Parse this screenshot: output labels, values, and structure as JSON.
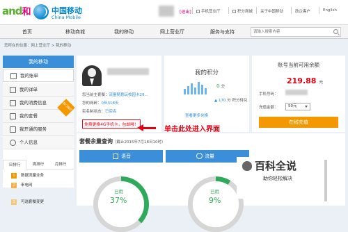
{
  "brand": {
    "and_text": "and",
    "he_text": "和",
    "name_cn": "中国移动",
    "name_en": "China Mobile"
  },
  "header": {
    "logout": "[退出]",
    "links": [
      "手机营业厅",
      "积分商城",
      "关于中国移动",
      "政企客户",
      "English"
    ]
  },
  "nav": {
    "items": [
      "首页",
      "移动商城",
      "我的移动",
      "网上营业厅",
      "服务与支持"
    ],
    "search_placeholder": "请输入搜索内容"
  },
  "breadcrumb": "您所在的位置：网上营业厅 > 我的移动",
  "sidebar": {
    "title": "我的移动",
    "items": [
      "我的账单",
      "我的详单",
      "我的消费信息",
      "我的套餐",
      "我开通的服务",
      "个人信息"
    ],
    "rank_tabs": [
      "日排行",
      "周排行",
      "月排行"
    ],
    "ribbon": "热门排行",
    "rank_rows": [
      {
        "num": "1",
        "label": "数据流量业务"
      },
      {
        "num": "2",
        "label": "来电网"
      },
      {
        "num": "3",
        "label": "可选套餐变更"
      }
    ]
  },
  "profile": {
    "plan_label": "您当前主套餐：",
    "plan_value": "流量随意玩校园卡29...",
    "network_label": "您的网龄：",
    "network_value": "0年318天",
    "realname_label": "实名制状态：",
    "realname_value": "已实名",
    "promo_link": "免费更换4G手机卡，包邮哦！"
  },
  "points": {
    "title": "我的积分",
    "value": "0",
    "unit": "分",
    "earned_prefix": "▲",
    "earned_value": "170",
    "earned_suffix": "分 积分待兑",
    "more_link": "查看更多兑换"
  },
  "balance": {
    "title": "账号当前可用余额",
    "amount": "219.88",
    "currency": "元",
    "phone_label": "手机号码：",
    "amount_label": "充值金额：",
    "amount_option": "50元",
    "recharge_button": "在线充值"
  },
  "annotation": "单击此处进入界面",
  "package": {
    "title": "套餐余量查询",
    "subtitle": "（截止2015年7月18日10时）",
    "tabs": [
      "语音",
      "流量"
    ],
    "used_label": "已用",
    "voice_used_pct": "37%",
    "data_used_pct": "9%",
    "voice_used_fraction": 0.37,
    "data_used_fraction": 0.09
  },
  "watermark": {
    "title": "百科全说",
    "subtitle": "助你轻松解决"
  },
  "colors": {
    "accent": "#3b8fd8",
    "brand_green": "#5bb22b",
    "brand_pink": "#e4007f",
    "alert_red": "#e60012",
    "orange": "#f39800"
  }
}
